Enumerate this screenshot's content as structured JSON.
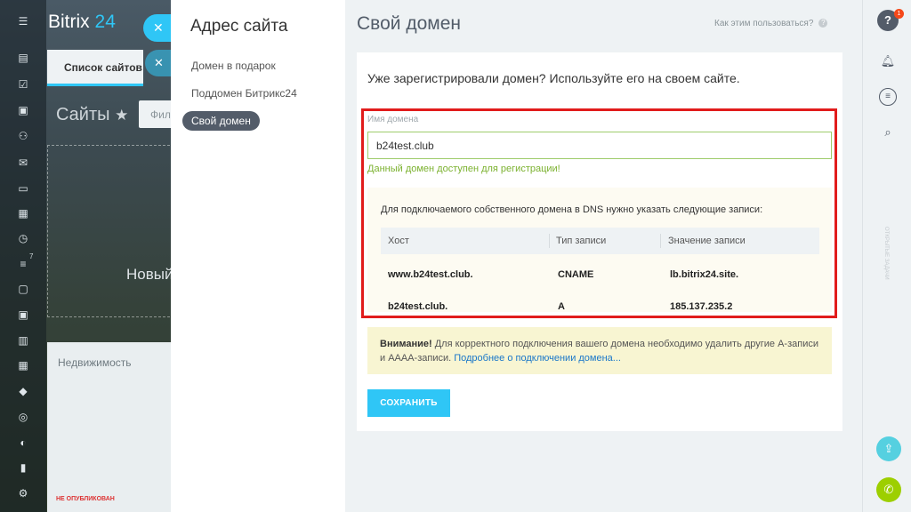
{
  "app": {
    "logo_text": "Bitrix",
    "logo_num": "24",
    "tab_list_label": "Список сайтов",
    "sites_title": "Сайты",
    "filter_placeholder": "Фильтр",
    "new_site_label": "Новый",
    "realty_label": "Недвижимость",
    "unpublished_label": "НЕ ОПУБЛИКОВАН",
    "rail_badge": "7"
  },
  "slider": {
    "nav_title": "Адрес сайта",
    "nav_items": [
      {
        "label": "Домен в подарок",
        "active": false
      },
      {
        "label": "Поддомен Битрикс24",
        "active": false
      },
      {
        "label": "Свой домен",
        "active": true
      }
    ],
    "title": "Свой домен",
    "howto_link": "Как этим пользоваться?",
    "intro": "Уже зарегистрировали домен? Используйте его на своем сайте.",
    "field_label": "Имя домена",
    "domain_value": "b24test.club",
    "available_message": "Данный домен доступен для регистрации!",
    "dns_intro": "Для подключаемого собственного домена в DNS нужно указать следующие записи:",
    "dns_headers": [
      "Хост",
      "Тип записи",
      "Значение записи"
    ],
    "dns_rows": [
      [
        "www.b24test.club.",
        "CNAME",
        "lb.bitrix24.site."
      ],
      [
        "b24test.club.",
        "A",
        "185.137.235.2"
      ]
    ],
    "warning_bold": "Внимание!",
    "warning_text": " Для корректного подключения вашего домена необходимо удалить другие A-записи и AAAA-записи. ",
    "warning_link": "Подробнее о подключении домена...",
    "save_label": "СОХРАНИТЬ"
  },
  "right_rail": {
    "help_badge": "1",
    "vertical_text": "ОТКРЫТЫЕ ЗАДАЧИ"
  },
  "colors": {
    "accent": "#2fc6f6",
    "highlight_frame": "#e11c1c",
    "success_text": "#7bb12f",
    "warning_bg": "#f8f5d2",
    "link": "#1a77c9"
  },
  "icons": [
    "menu-icon",
    "close-icon",
    "star-icon",
    "question-icon",
    "bell-icon",
    "chat-icon",
    "search-icon",
    "phone-icon",
    "share-icon"
  ]
}
